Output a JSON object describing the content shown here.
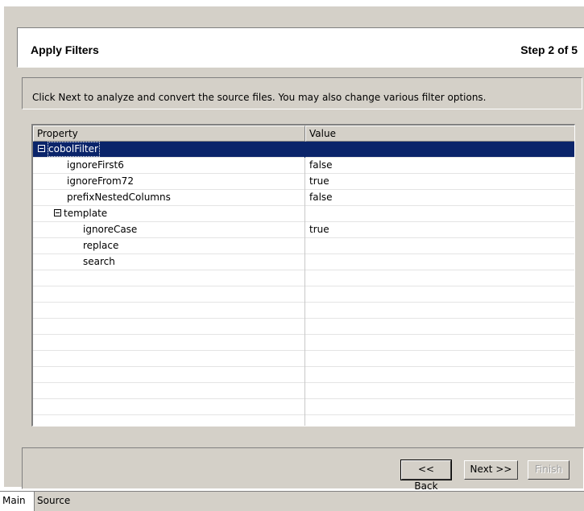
{
  "wizard": {
    "title": "Apply Filters",
    "step": "Step 2 of 5",
    "instructions": "Click Next to analyze and convert the source files. You may also change various filter options."
  },
  "table": {
    "columns": [
      "Property",
      "Value"
    ],
    "rows": [
      {
        "property": "cobolFilter",
        "value": ""
      },
      {
        "property": "ignoreFirst6",
        "value": "false"
      },
      {
        "property": "ignoreFrom72",
        "value": "true"
      },
      {
        "property": "prefixNestedColumns",
        "value": "false"
      },
      {
        "property": "template",
        "value": ""
      },
      {
        "property": "ignoreCase",
        "value": "true"
      },
      {
        "property": "replace",
        "value": ""
      },
      {
        "property": "search",
        "value": ""
      }
    ]
  },
  "buttons": {
    "back": "<< Back",
    "next": "Next >>",
    "finish": "Finish"
  },
  "tabs": {
    "main": "Main",
    "source": "Source"
  }
}
